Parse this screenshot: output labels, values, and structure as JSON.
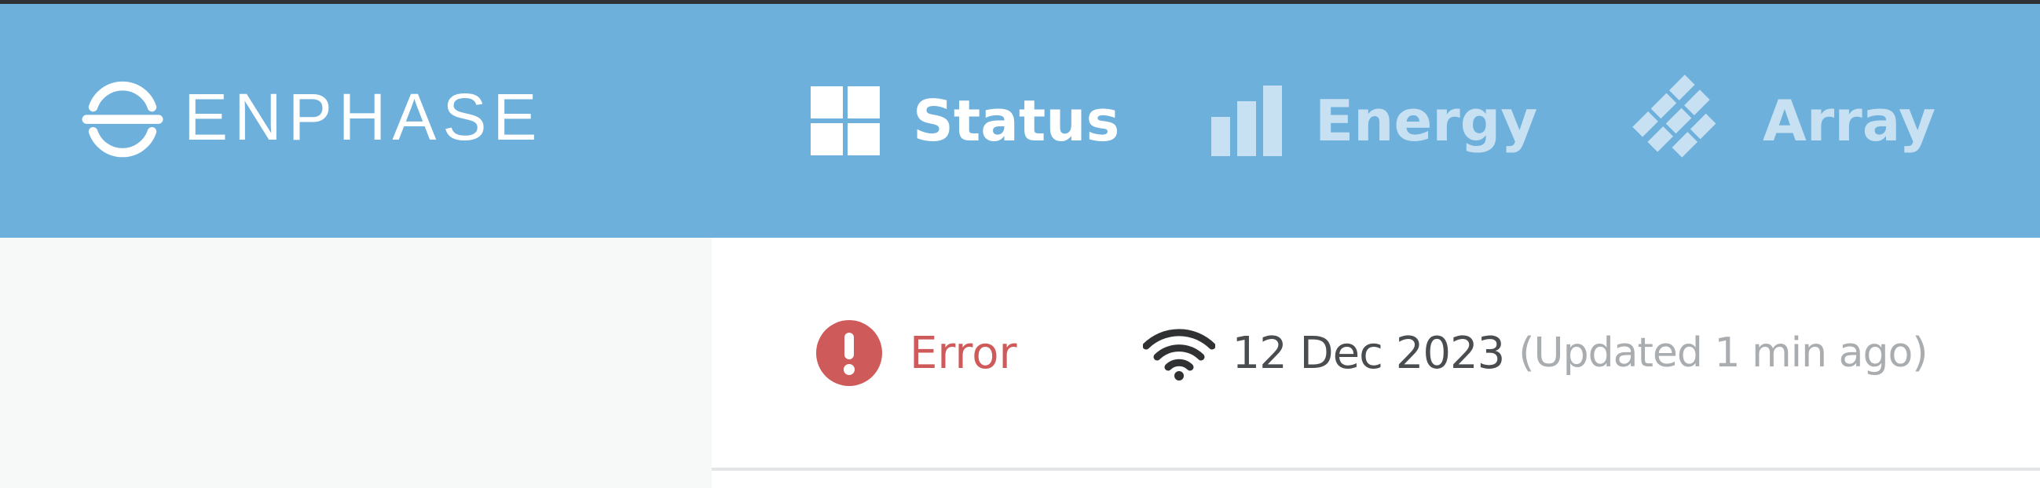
{
  "brand": {
    "logo_text": "ENPHASE",
    "logo_icon": "enphase-logo-icon"
  },
  "nav": {
    "items": [
      {
        "label": "Status",
        "icon": "grid-icon",
        "active": true
      },
      {
        "label": "Energy",
        "icon": "bar-chart-icon",
        "active": false
      },
      {
        "label": "Array",
        "icon": "panel-array-icon",
        "active": false
      }
    ]
  },
  "status": {
    "state": "Error",
    "state_icon": "error-exclamation-icon",
    "connection_icon": "wifi-icon",
    "date": "12 Dec 2023",
    "updated": "(Updated 1 min ago)"
  },
  "colors": {
    "header": "#6eb0dc",
    "error": "#cf5a5a",
    "text_dark": "#4a4d50",
    "text_muted": "#a9adb0",
    "panel_light": "#f7f8f8"
  }
}
